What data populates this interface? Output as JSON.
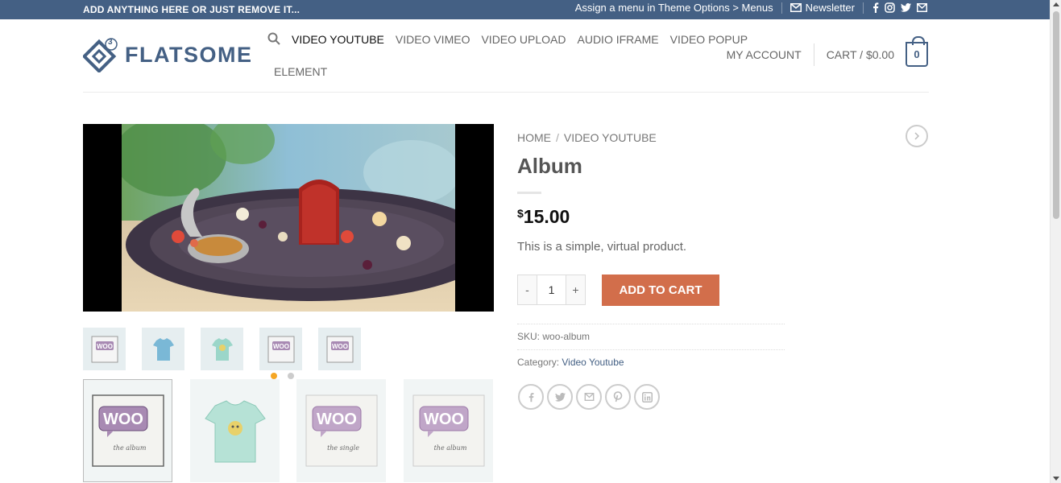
{
  "topbar": {
    "left_text": "ADD ANYTHING HERE OR JUST REMOVE IT...",
    "menu_text": "Assign a menu in Theme Options > Menus",
    "newsletter": "Newsletter",
    "social_icons": [
      "facebook-icon",
      "instagram-icon",
      "twitter-icon",
      "email-icon"
    ]
  },
  "header": {
    "logo_text": "FLATSOME",
    "logo_badge": "3",
    "nav_row1": [
      "VIDEO YOUTUBE",
      "VIDEO VIMEO",
      "VIDEO UPLOAD",
      "AUDIO IFRAME",
      "VIDEO POPUP"
    ],
    "nav_row2": [
      "ELEMENT"
    ],
    "account": "MY ACCOUNT",
    "cart_label": "CART / $0.00",
    "cart_count": "0"
  },
  "product": {
    "breadcrumb_home": "HOME",
    "breadcrumb_divider": "/",
    "breadcrumb_category": "VIDEO YOUTUBE",
    "title": "Album",
    "currency": "$",
    "price": "15.00",
    "description": "This is a simple, virtual product.",
    "qty_minus": "-",
    "qty_value": "1",
    "qty_plus": "+",
    "add_to_cart": "ADD TO CART",
    "sku_label": "SKU:",
    "sku_value": "woo-album",
    "category_label": "Category:",
    "category_value": "Video Youtube",
    "share_icons": [
      "facebook-icon",
      "twitter-icon",
      "email-icon",
      "pinterest-icon",
      "linkedin-icon"
    ]
  },
  "gallery": {
    "thumbs": [
      "woo-album",
      "tshirt-blue",
      "tshirt-green",
      "woo-album",
      "woo-album"
    ],
    "dots_active": 0,
    "dots_count": 2,
    "large": [
      {
        "label": "the album",
        "kind": "woo"
      },
      {
        "label": "",
        "kind": "tshirt"
      },
      {
        "label": "the single",
        "kind": "woo"
      },
      {
        "label": "the album",
        "kind": "woo"
      }
    ]
  },
  "colors": {
    "brand": "#446084",
    "accent": "#d26e4b",
    "dot_active": "#f5a623"
  }
}
